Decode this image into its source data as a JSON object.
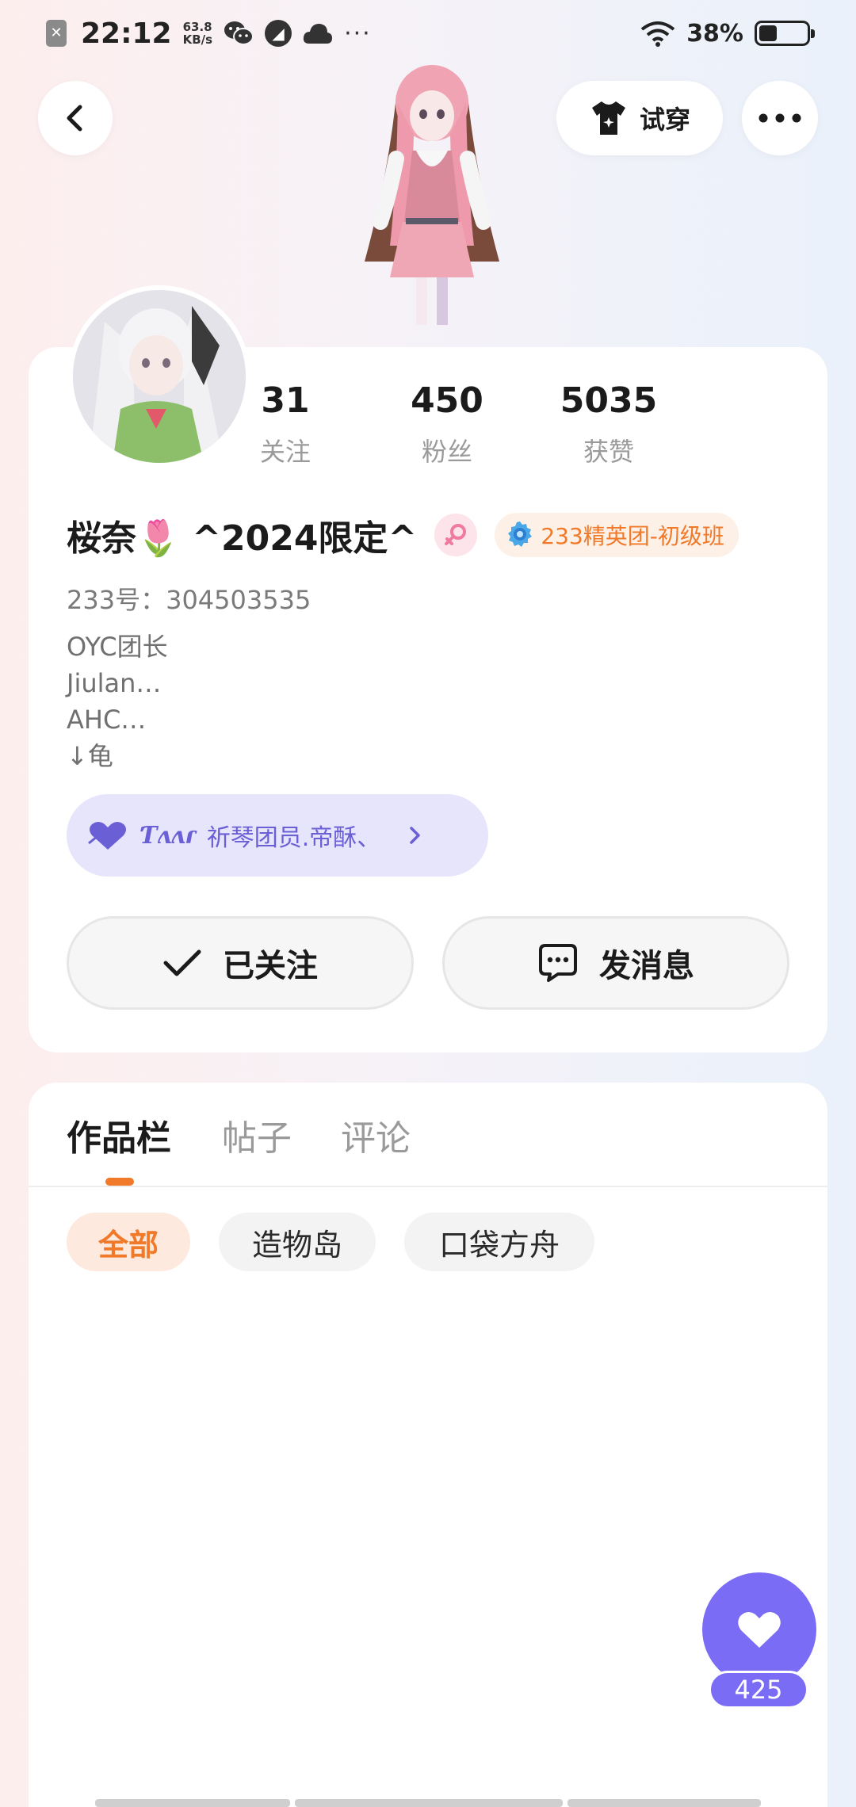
{
  "status_bar": {
    "time": "22:12",
    "speed_value": "63.8",
    "speed_unit": "KB/s",
    "battery_percent": "38%",
    "battery_level": 0.38,
    "icons": [
      "notification-x-icon",
      "wechat-icon",
      "compass-icon",
      "cloud-icon",
      "more-dots-icon",
      "wifi-icon",
      "battery-icon"
    ]
  },
  "nav": {
    "back_icon": "back-arrow-icon",
    "tryon_label": "试穿",
    "tryon_icon": "tshirt-icon",
    "more_icon": "more-dots-icon"
  },
  "profile": {
    "stats": [
      {
        "value": "31",
        "label": "关注"
      },
      {
        "value": "450",
        "label": "粉丝"
      },
      {
        "value": "5035",
        "label": "获赞"
      }
    ],
    "name": "桜奈🌷 ^2024限定^",
    "gender_icon": "female-icon",
    "group_badge": "233精英团-初级班",
    "group_badge_color": "#f07a2a",
    "user_id": "233号：304503535",
    "bio_lines": [
      "OYC团长",
      "Jiulan…",
      "AHC…",
      "↓龟"
    ],
    "fan_group": {
      "signature": "Ƭʌʌɾ",
      "label": "祈琴团员.帝酥、",
      "icon": "heart-icon",
      "arrow_icon": "chevron-right-icon"
    },
    "follow_label": "已关注",
    "message_label": "发消息"
  },
  "works": {
    "tabs": [
      "作品栏",
      "帖子",
      "评论"
    ],
    "active_tab": 0,
    "filters": [
      "全部",
      "造物岛",
      "口袋方舟"
    ],
    "active_filter": 0,
    "accent": "#f07a2a"
  },
  "like": {
    "count": "425",
    "color": "#7a6cf4",
    "icon": "heart-icon"
  }
}
